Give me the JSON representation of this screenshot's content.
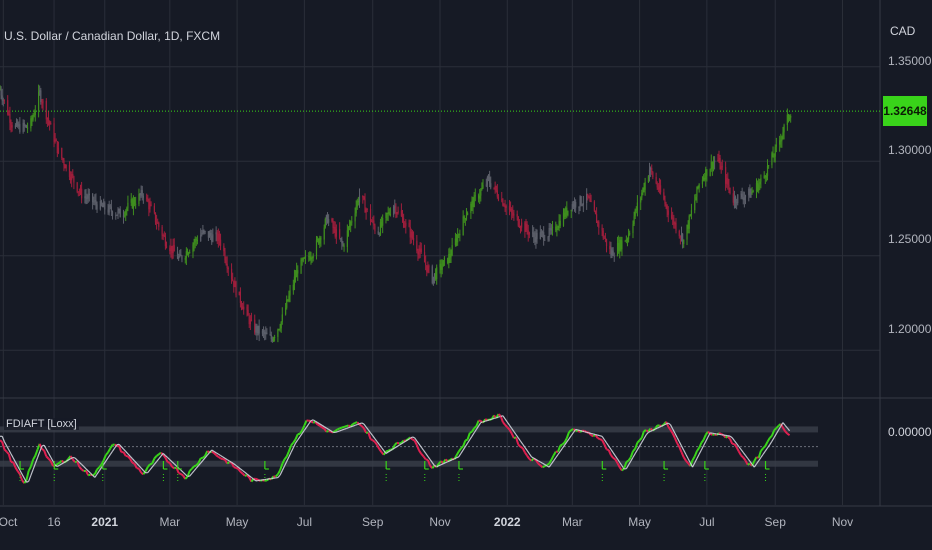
{
  "chart_title": "U.S. Dollar / Canadian Dollar, 1D, FXCM",
  "indicator_label": "FDIAFT [Loxx]",
  "currency": "CAD",
  "colors": {
    "background": "#161a25",
    "grid": "#2a2e39",
    "up": "#3f8f1e",
    "down": "#a01e3c",
    "neutral": "#5d606b",
    "price_line": "#39d31a",
    "badge": "#39d31a",
    "fish_up": "#39d31a",
    "fish_down": "#e02050",
    "trigger": "#d1d4dc",
    "signal": "#39d31a"
  },
  "chart_data": [
    {
      "type": "candlestick",
      "y_ticks": [
        "1.35000",
        "1.30000",
        "1.25000",
        "1.20000"
      ],
      "y_tick_values": [
        1.35,
        1.3,
        1.25,
        1.2
      ],
      "ylim": [
        1.18,
        1.38
      ],
      "last_price": 1.32648,
      "last_price_label": "1.32648",
      "x_ticks": [
        {
          "label": "Oct",
          "date": "2020-10-01"
        },
        {
          "label": "16",
          "date": "2020-11-16"
        },
        {
          "label": "2021",
          "date": "2021-01-01",
          "year": true
        },
        {
          "label": "Mar",
          "date": "2021-03-01"
        },
        {
          "label": "May",
          "date": "2021-05-01"
        },
        {
          "label": "Jul",
          "date": "2021-07-01"
        },
        {
          "label": "Sep",
          "date": "2021-09-01"
        },
        {
          "label": "Nov",
          "date": "2021-11-01"
        },
        {
          "label": "2022",
          "date": "2022-01-01",
          "year": true
        },
        {
          "label": "Mar",
          "date": "2022-03-01"
        },
        {
          "label": "May",
          "date": "2022-05-01"
        },
        {
          "label": "Jul",
          "date": "2022-07-01"
        },
        {
          "label": "Sep",
          "date": "2022-09-01"
        },
        {
          "label": "Nov",
          "date": "2022-11-01"
        }
      ],
      "x_range": [
        "2020-09-28",
        "2022-12-05"
      ],
      "path": [
        [
          "2020-09-28",
          1.338
        ],
        [
          "2020-10-10",
          1.318
        ],
        [
          "2020-10-25",
          1.318
        ],
        [
          "2020-11-03",
          1.336
        ],
        [
          "2020-11-20",
          1.305
        ],
        [
          "2020-12-10",
          1.283
        ],
        [
          "2020-12-28",
          1.276
        ],
        [
          "2021-01-15",
          1.272
        ],
        [
          "2021-02-05",
          1.283
        ],
        [
          "2021-02-25",
          1.258
        ],
        [
          "2021-03-10",
          1.248
        ],
        [
          "2021-03-30",
          1.262
        ],
        [
          "2021-04-15",
          1.259
        ],
        [
          "2021-04-30",
          1.232
        ],
        [
          "2021-05-15",
          1.212
        ],
        [
          "2021-06-01",
          1.206
        ],
        [
          "2021-06-10",
          1.215
        ],
        [
          "2021-06-25",
          1.243
        ],
        [
          "2021-07-10",
          1.253
        ],
        [
          "2021-07-22",
          1.27
        ],
        [
          "2021-08-05",
          1.255
        ],
        [
          "2021-08-20",
          1.282
        ],
        [
          "2021-09-05",
          1.262
        ],
        [
          "2021-09-20",
          1.277
        ],
        [
          "2021-10-05",
          1.262
        ],
        [
          "2021-10-25",
          1.238
        ],
        [
          "2021-11-10",
          1.25
        ],
        [
          "2021-11-25",
          1.273
        ],
        [
          "2021-12-15",
          1.29
        ],
        [
          "2022-01-05",
          1.272
        ],
        [
          "2022-01-25",
          1.26
        ],
        [
          "2022-02-10",
          1.262
        ],
        [
          "2022-02-28",
          1.277
        ],
        [
          "2022-03-15",
          1.28
        ],
        [
          "2022-04-05",
          1.251
        ],
        [
          "2022-04-20",
          1.26
        ],
        [
          "2022-05-10",
          1.296
        ],
        [
          "2022-05-30",
          1.27
        ],
        [
          "2022-06-10",
          1.258
        ],
        [
          "2022-06-25",
          1.29
        ],
        [
          "2022-07-10",
          1.302
        ],
        [
          "2022-07-25",
          1.28
        ],
        [
          "2022-08-10",
          1.283
        ],
        [
          "2022-08-20",
          1.29
        ],
        [
          "2022-09-01",
          1.305
        ],
        [
          "2022-09-08",
          1.316
        ],
        [
          "2022-09-15",
          1.3265
        ]
      ]
    },
    {
      "type": "line",
      "name": "FDIAFT",
      "y_ticks": [
        "0.00000"
      ],
      "y_tick_values": [
        0
      ],
      "ylim": [
        -1.5,
        1.3
      ],
      "levels": [
        0.5,
        0,
        -0.5
      ],
      "path": [
        [
          "2020-09-28",
          0.2
        ],
        [
          "2020-10-20",
          -1.1
        ],
        [
          "2020-11-03",
          0.1
        ],
        [
          "2020-11-15",
          -0.6
        ],
        [
          "2020-12-01",
          -0.3
        ],
        [
          "2020-12-20",
          -0.9
        ],
        [
          "2021-01-10",
          0.1
        ],
        [
          "2021-02-05",
          -0.8
        ],
        [
          "2021-02-20",
          -0.2
        ],
        [
          "2021-03-15",
          -0.9
        ],
        [
          "2021-04-05",
          -0.1
        ],
        [
          "2021-04-25",
          -0.5
        ],
        [
          "2021-05-15",
          -1.0
        ],
        [
          "2021-06-05",
          -0.9
        ],
        [
          "2021-06-20",
          0.1
        ],
        [
          "2021-07-05",
          0.8
        ],
        [
          "2021-07-25",
          0.4
        ],
        [
          "2021-08-20",
          0.7
        ],
        [
          "2021-09-10",
          -0.2
        ],
        [
          "2021-10-05",
          0.3
        ],
        [
          "2021-10-25",
          -0.6
        ],
        [
          "2021-11-15",
          -0.3
        ],
        [
          "2021-12-05",
          0.7
        ],
        [
          "2021-12-25",
          0.9
        ],
        [
          "2022-01-20",
          -0.3
        ],
        [
          "2022-02-05",
          -0.6
        ],
        [
          "2022-03-01",
          0.5
        ],
        [
          "2022-03-25",
          0.3
        ],
        [
          "2022-04-15",
          -0.7
        ],
        [
          "2022-05-05",
          0.4
        ],
        [
          "2022-05-25",
          0.7
        ],
        [
          "2022-06-15",
          -0.6
        ],
        [
          "2022-07-01",
          0.4
        ],
        [
          "2022-07-20",
          0.3
        ],
        [
          "2022-08-10",
          -0.6
        ],
        [
          "2022-08-25",
          0.1
        ],
        [
          "2022-09-05",
          0.7
        ],
        [
          "2022-09-15",
          0.3
        ]
      ],
      "markers": [
        "2020-10-18",
        "2020-11-18",
        "2021-01-01",
        "2021-02-25",
        "2021-03-10",
        "2021-05-28",
        "2021-09-15",
        "2021-10-20",
        "2021-11-20",
        "2022-03-30",
        "2022-05-25",
        "2022-07-01",
        "2022-08-25"
      ]
    }
  ]
}
